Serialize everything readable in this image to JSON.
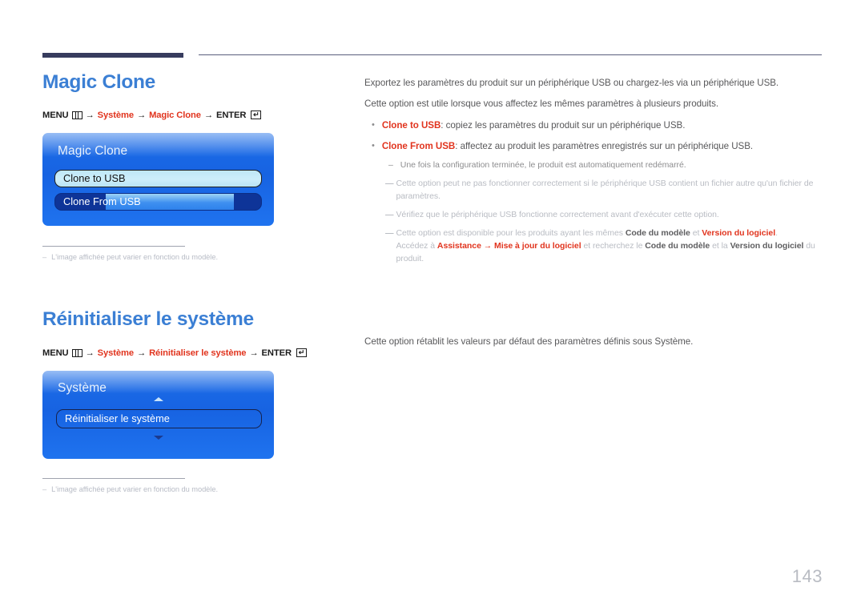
{
  "page": {
    "number": "143"
  },
  "sections": [
    {
      "title": "Magic Clone",
      "menu_path": {
        "menu_label": "MENU",
        "menu_icon": "menu-grid-icon",
        "steps": [
          "Système",
          "Magic Clone"
        ],
        "enter_label": "ENTER",
        "enter_icon": "enter-return-icon",
        "arrow": "→"
      },
      "osd": {
        "title": "Magic Clone",
        "rows": [
          {
            "label": "Clone to USB",
            "state": "selected"
          },
          {
            "label": "Clone From USB",
            "state": "dark-with-bar"
          }
        ]
      },
      "footnote": {
        "dash": "–",
        "text": "L'image affichée peut varier en fonction du modèle."
      },
      "body": {
        "paragraphs": [
          "Exportez les paramètres du produit sur un périphérique USB ou chargez-les via un périphérique USB.",
          "Cette option est utile lorsque vous affectez les mêmes paramètres à plusieurs produits."
        ],
        "bullets": [
          {
            "dot": "•",
            "term": "Clone to USB",
            "rest": ": copiez les paramètres du produit sur un périphérique USB."
          },
          {
            "dot": "•",
            "term": "Clone From USB",
            "rest": ": affectez au produit les paramètres enregistrés sur un périphérique USB."
          }
        ],
        "sub_note": {
          "dash": "–",
          "text": "Une fois la configuration terminée, le produit est automatiquement redémarré."
        },
        "notes": [
          {
            "dash": "―",
            "text": "Cette option peut ne pas fonctionner correctement si le périphérique USB contient un fichier autre qu'un fichier de paramètres."
          },
          {
            "dash": "―",
            "text": "Vérifiez que le périphérique USB fonctionne correctement avant d'exécuter cette option."
          }
        ],
        "rich_note": {
          "dash": "―",
          "line1_a": "Cette option est disponible pour les produits ayant les mêmes ",
          "line1_b1": "Code du modèle",
          "line1_c": " et ",
          "line1_b2": "Version du logiciel",
          "line1_d": ".",
          "line2_a": "Accédez à ",
          "line2_b1": "Assistance",
          "line2_arrow": " → ",
          "line2_b2": "Mise à jour du logiciel",
          "line2_c": " et recherchez le ",
          "line2_b3": "Code du modèle",
          "line2_d": " et la ",
          "line2_b4": "Version du logiciel",
          "line2_e": " du",
          "line3": "produit."
        }
      }
    },
    {
      "title": "Réinitialiser le système",
      "menu_path": {
        "menu_label": "MENU",
        "menu_icon": "menu-grid-icon",
        "steps": [
          "Système",
          "Réinitialiser le système"
        ],
        "enter_label": "ENTER",
        "enter_icon": "enter-return-icon",
        "arrow": "→"
      },
      "osd": {
        "title": "Système",
        "scroll_up_icon": "caret-up-icon",
        "scroll_down_icon": "caret-down-icon",
        "rows": [
          {
            "label": "Réinitialiser le système",
            "state": "outline"
          }
        ]
      },
      "footnote": {
        "dash": "–",
        "text": "L'image affichée peut varier en fonction du modèle."
      },
      "body": {
        "paragraphs": [
          "Cette option rétablit les valeurs par défaut des paramètres définis sous Système."
        ]
      }
    }
  ],
  "colors": {
    "heading_blue": "#3b7fd4",
    "accent_red": "#e1341e",
    "rule_navy": "#373c5e",
    "osd_blue": "#1c6de8"
  }
}
